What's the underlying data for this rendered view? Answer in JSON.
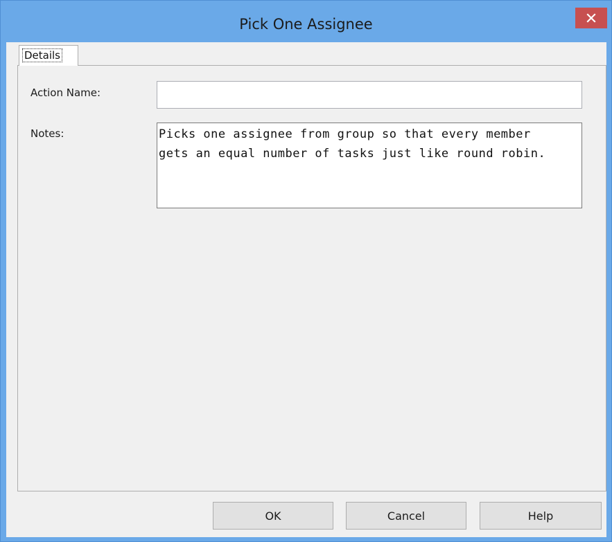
{
  "window": {
    "title": "Pick One Assignee",
    "close_icon": "close-icon",
    "accent_color": "#6aa9e8",
    "close_color": "#c75050"
  },
  "tabs": [
    {
      "label": "Details",
      "selected": true
    }
  ],
  "form": {
    "action_name_label": "Action Name:",
    "action_name_value": "",
    "notes_label": "Notes:",
    "notes_value": "Picks one assignee from group so that every member\ngets an equal number of tasks just like round robin."
  },
  "buttons": {
    "ok": "OK",
    "cancel": "Cancel",
    "help": "Help"
  }
}
